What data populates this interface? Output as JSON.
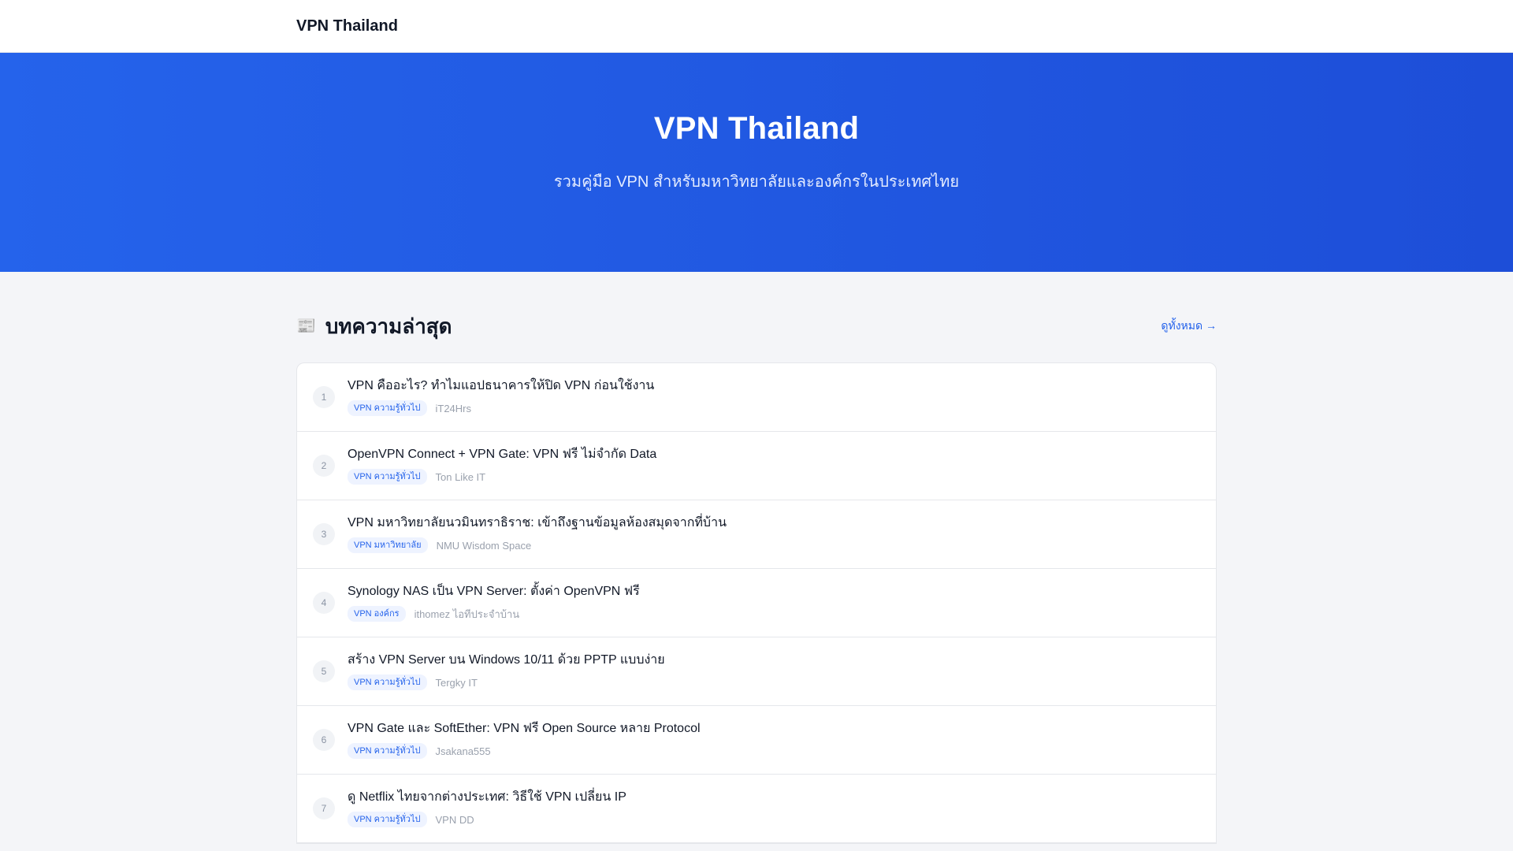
{
  "header": {
    "brand": "VPN Thailand"
  },
  "hero": {
    "title": "VPN Thailand",
    "subtitle": "รวมคู่มือ VPN สำหรับมหาวิทยาลัยและองค์กรในประเทศไทย"
  },
  "section": {
    "icon": "📰",
    "icon_name": "newspaper-icon",
    "title": "บทความล่าสุด",
    "view_all": "ดูทั้งหมด →"
  },
  "articles": [
    {
      "num": "1",
      "title": "VPN คืออะไร? ทำไมแอปธนาคารให้ปิด VPN ก่อนใช้งาน",
      "tag": "VPN ความรู้ทั่วไป",
      "source": "iT24Hrs"
    },
    {
      "num": "2",
      "title": "OpenVPN Connect + VPN Gate: VPN ฟรี ไม่จำกัด Data",
      "tag": "VPN ความรู้ทั่วไป",
      "source": "Ton Like IT"
    },
    {
      "num": "3",
      "title": "VPN มหาวิทยาลัยนวมินทราธิราช: เข้าถึงฐานข้อมูลห้องสมุดจากที่บ้าน",
      "tag": "VPN มหาวิทยาลัย",
      "source": "NMU Wisdom Space"
    },
    {
      "num": "4",
      "title": "Synology NAS เป็น VPN Server: ตั้งค่า OpenVPN ฟรี",
      "tag": "VPN องค์กร",
      "source": "ithomez ไอทีประจำบ้าน"
    },
    {
      "num": "5",
      "title": "สร้าง VPN Server บน Windows 10/11 ด้วย PPTP แบบง่าย",
      "tag": "VPN ความรู้ทั่วไป",
      "source": "Tergky IT"
    },
    {
      "num": "6",
      "title": "VPN Gate และ SoftEther: VPN ฟรี Open Source หลาย Protocol",
      "tag": "VPN ความรู้ทั่วไป",
      "source": "Jsakana555"
    },
    {
      "num": "7",
      "title": "ดู Netflix ไทยจากต่างประเทศ: วิธีใช้ VPN เปลี่ยน IP",
      "tag": "VPN ความรู้ทั่วไป",
      "source": "VPN DD"
    }
  ]
}
